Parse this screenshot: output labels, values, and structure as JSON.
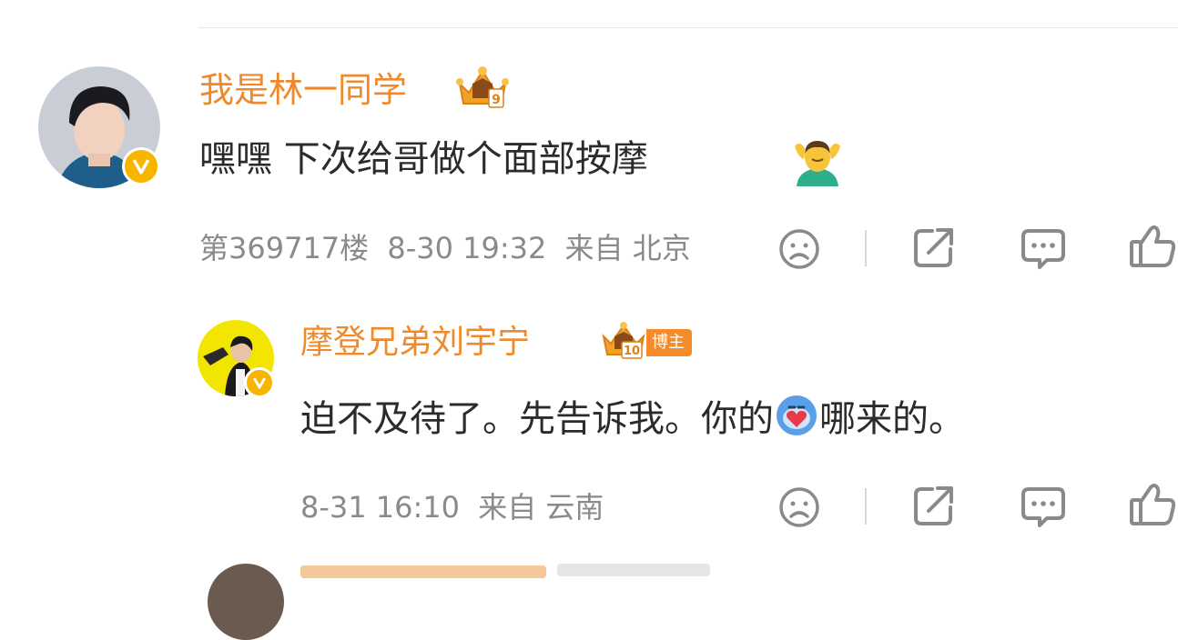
{
  "comments": [
    {
      "username": "我是林一同学",
      "rank_badge": "crown-level-9-icon",
      "text": "嘿嘿 下次给哥做个面部按摩",
      "emoji": "man-getting-massage-emoji",
      "floor": "第369717楼",
      "datetime": "8-30 19:32",
      "location": "来自 北京"
    },
    {
      "username": "摩登兄弟刘宇宁",
      "rank_badge": "crown-level-10-icon",
      "role_tag": "博主",
      "text_before": "迫不及待了。先告诉我。你的",
      "sticker": "heart-sticker-emoji",
      "text_after": "哪来的。",
      "datetime": "8-31 16:10",
      "location": "来自 云南"
    }
  ],
  "colors": {
    "username": "#ee8a2b",
    "verified_badge": "#f7b500",
    "role_tag_bg": "#f68b2c",
    "meta_text": "#8a8a8a"
  }
}
